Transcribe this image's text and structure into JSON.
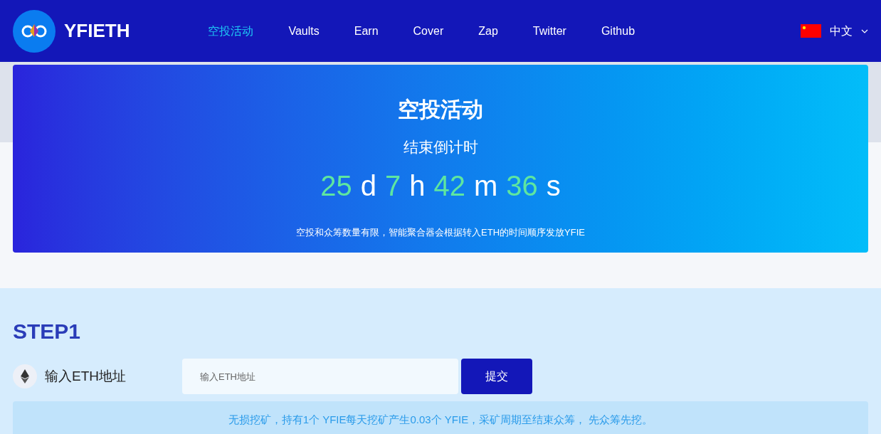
{
  "header": {
    "brand": "YFIETH",
    "nav": [
      {
        "label": "空投活动",
        "selected": true
      },
      {
        "label": "Vaults",
        "selected": false
      },
      {
        "label": "Earn",
        "selected": false
      },
      {
        "label": "Cover",
        "selected": false
      },
      {
        "label": "Zap",
        "selected": false
      },
      {
        "label": "Twitter",
        "selected": false
      },
      {
        "label": "Github",
        "selected": false
      }
    ],
    "language": "中文"
  },
  "banner": {
    "title": "空投活动",
    "subtitle": "结束倒计时",
    "countdown": [
      {
        "value": "25",
        "unit": "d"
      },
      {
        "value": "7",
        "unit": "h"
      },
      {
        "value": "42",
        "unit": "m"
      },
      {
        "value": "36",
        "unit": "s"
      }
    ],
    "note": "空投和众筹数量有限，智能聚合器会根据转入ETH的时间顺序发放YFIE"
  },
  "step": {
    "title": "STEP1",
    "label": "输入ETH地址",
    "field": {
      "placeholder": "输入ETH地址"
    },
    "button": "提交",
    "info": "无损挖矿，持有1个 YFIE每天挖矿产生0.03个 YFIE，采矿周期至结束众筹， 先众筹先挖。"
  }
}
